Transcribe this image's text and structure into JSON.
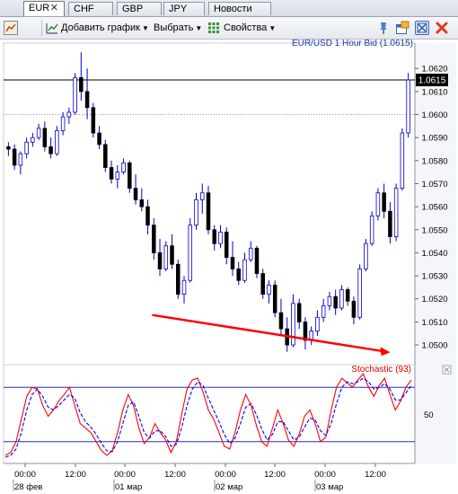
{
  "tabs": [
    {
      "label": "EUR",
      "close": "✕",
      "active": true
    },
    {
      "label": "CHF"
    },
    {
      "label": "GBP"
    },
    {
      "label": "JPY"
    },
    {
      "label": "Новости"
    }
  ],
  "toolbar": {
    "add_chart_label": "Добавить график",
    "select_label": "Выбрать",
    "properties_label": "Свойства"
  },
  "icons": [
    "chart-panel-icon",
    "layout-icon",
    "add-chart-icon",
    "properties-icon",
    "pin-icon",
    "new-window-icon",
    "zoom-icon",
    "close-icon"
  ],
  "colors": {
    "candle": "#0000cc",
    "stoch_main": "#ff0000",
    "stoch_signal": "#0000ff",
    "arrow": "#ff0000",
    "last_price_line": "#000000"
  },
  "chart_data": [
    {
      "type": "candlestick",
      "title": "EUR/USD 1 Hour Bid (1.0615)",
      "last_price": "1.0615",
      "y_tick_labels": [
        "1.0620",
        "1.0610",
        "1.0600",
        "1.0590",
        "1.0580",
        "1.0570",
        "1.0560",
        "1.0550",
        "1.0540",
        "1.0530",
        "1.0520",
        "1.0510",
        "1.0500"
      ],
      "ylim": [
        1.0493,
        1.0631
      ],
      "x_tick_labels": [
        "00:00",
        "12:00",
        "00:00",
        "12:00",
        "00:00",
        "12:00",
        "00:00",
        "12:00"
      ],
      "date_labels": [
        "28 фев",
        "01 мар",
        "02 мар",
        "03 мар"
      ],
      "grid": false,
      "dotted_reference_level": 1.06,
      "candles": [
        [
          1.0586,
          1.0588,
          1.0582,
          1.0585
        ],
        [
          1.0585,
          1.0587,
          1.0576,
          1.0578
        ],
        [
          1.0578,
          1.0584,
          1.0574,
          1.0583
        ],
        [
          1.0583,
          1.059,
          1.0581,
          1.0588
        ],
        [
          1.0588,
          1.0592,
          1.0586,
          1.059
        ],
        [
          1.059,
          1.0596,
          1.0589,
          1.0594
        ],
        [
          1.0594,
          1.0597,
          1.0584,
          1.0586
        ],
        [
          1.0586,
          1.059,
          1.0581,
          1.0583
        ],
        [
          1.0583,
          1.0595,
          1.0582,
          1.0593
        ],
        [
          1.0593,
          1.0601,
          1.0591,
          1.0599
        ],
        [
          1.0599,
          1.0603,
          1.0596,
          1.0601
        ],
        [
          1.0601,
          1.0618,
          1.06,
          1.0616
        ],
        [
          1.0616,
          1.0627,
          1.0606,
          1.061
        ],
        [
          1.061,
          1.062,
          1.0598,
          1.0603
        ],
        [
          1.0603,
          1.0605,
          1.059,
          1.0592
        ],
        [
          1.0592,
          1.0595,
          1.0585,
          1.0587
        ],
        [
          1.0587,
          1.0589,
          1.0575,
          1.0577
        ],
        [
          1.0577,
          1.058,
          1.057,
          1.0572
        ],
        [
          1.0572,
          1.0578,
          1.0568,
          1.0575
        ],
        [
          1.0575,
          1.0581,
          1.0574,
          1.0579
        ],
        [
          1.0579,
          1.058,
          1.0566,
          1.0568
        ],
        [
          1.0568,
          1.0574,
          1.0561,
          1.0563
        ],
        [
          1.0563,
          1.0568,
          1.0558,
          1.056
        ],
        [
          1.056,
          1.0563,
          1.0548,
          1.0552
        ],
        [
          1.0552,
          1.0555,
          1.0537,
          1.054
        ],
        [
          1.054,
          1.0546,
          1.053,
          1.0533
        ],
        [
          1.0533,
          1.0545,
          1.0532,
          1.0543
        ],
        [
          1.0543,
          1.0548,
          1.0533,
          1.0535
        ],
        [
          1.0535,
          1.0537,
          1.052,
          1.0522
        ],
        [
          1.0522,
          1.053,
          1.0518,
          1.0528
        ],
        [
          1.0528,
          1.0555,
          1.0527,
          1.0552
        ],
        [
          1.0552,
          1.0566,
          1.055,
          1.0563
        ],
        [
          1.0563,
          1.057,
          1.0557,
          1.0566
        ],
        [
          1.0566,
          1.0569,
          1.0548,
          1.055
        ],
        [
          1.055,
          1.0552,
          1.0541,
          1.0544
        ],
        [
          1.0544,
          1.0552,
          1.0542,
          1.0549
        ],
        [
          1.0549,
          1.0551,
          1.0535,
          1.0538
        ],
        [
          1.0538,
          1.0545,
          1.053,
          1.0533
        ],
        [
          1.0533,
          1.0536,
          1.0526,
          1.0528
        ],
        [
          1.0528,
          1.054,
          1.0527,
          1.0537
        ],
        [
          1.0537,
          1.0545,
          1.0536,
          1.0542
        ],
        [
          1.0542,
          1.0543,
          1.0529,
          1.0531
        ],
        [
          1.0531,
          1.0533,
          1.052,
          1.0522
        ],
        [
          1.0522,
          1.0528,
          1.0518,
          1.0526
        ],
        [
          1.0526,
          1.0528,
          1.0512,
          1.0514
        ],
        [
          1.0514,
          1.052,
          1.0504,
          1.0507
        ],
        [
          1.0507,
          1.0512,
          1.0497,
          1.05
        ],
        [
          1.05,
          1.0522,
          1.0499,
          1.0518
        ],
        [
          1.0518,
          1.052,
          1.0507,
          1.051
        ],
        [
          1.051,
          1.0512,
          1.0498,
          1.0502
        ],
        [
          1.0502,
          1.0508,
          1.05,
          1.0506
        ],
        [
          1.0506,
          1.0515,
          1.0504,
          1.0512
        ],
        [
          1.0512,
          1.052,
          1.051,
          1.0517
        ],
        [
          1.0517,
          1.0523,
          1.0515,
          1.0521
        ],
        [
          1.0521,
          1.0524,
          1.0513,
          1.0516
        ],
        [
          1.0516,
          1.0526,
          1.0515,
          1.0524
        ],
        [
          1.0524,
          1.0525,
          1.0517,
          1.0519
        ],
        [
          1.0519,
          1.0521,
          1.0509,
          1.0512
        ],
        [
          1.0512,
          1.0535,
          1.0511,
          1.0533
        ],
        [
          1.0533,
          1.0546,
          1.0532,
          1.0544
        ],
        [
          1.0544,
          1.0558,
          1.0543,
          1.0556
        ],
        [
          1.0556,
          1.0568,
          1.0554,
          1.0566
        ],
        [
          1.0566,
          1.057,
          1.0555,
          1.0558
        ],
        [
          1.0558,
          1.0562,
          1.0544,
          1.0547
        ],
        [
          1.0547,
          1.057,
          1.0545,
          1.0568
        ],
        [
          1.0568,
          1.0594,
          1.0567,
          1.0592
        ],
        [
          1.0592,
          1.0618,
          1.059,
          1.0615
        ]
      ]
    },
    {
      "type": "line",
      "title": "Stochastic (93)",
      "y_tick_labels": [
        "50"
      ],
      "ylim": [
        0,
        100
      ],
      "levels": [
        80,
        20
      ],
      "series": [
        {
          "values": [
            5,
            8,
            20,
            45,
            70,
            80,
            78,
            60,
            48,
            55,
            65,
            72,
            80,
            60,
            40,
            35,
            30,
            20,
            10,
            5,
            10,
            30,
            55,
            72,
            60,
            35,
            18,
            25,
            40,
            30,
            22,
            8,
            20,
            50,
            78,
            88,
            90,
            75,
            55,
            45,
            30,
            15,
            12,
            30,
            55,
            72,
            60,
            38,
            20,
            15,
            35,
            55,
            40,
            22,
            15,
            28,
            48,
            55,
            40,
            20,
            25,
            55,
            80,
            90,
            85,
            80,
            88,
            95,
            80,
            70,
            82,
            90,
            72,
            55,
            65,
            80,
            88
          ]
        },
        {
          "values": [
            3,
            5,
            12,
            30,
            55,
            72,
            78,
            70,
            58,
            55,
            60,
            66,
            72,
            68,
            52,
            42,
            36,
            28,
            18,
            10,
            9,
            20,
            40,
            60,
            64,
            48,
            30,
            24,
            32,
            32,
            26,
            15,
            17,
            35,
            60,
            78,
            86,
            82,
            68,
            55,
            42,
            28,
            18,
            24,
            40,
            58,
            62,
            50,
            34,
            22,
            28,
            42,
            42,
            32,
            22,
            25,
            36,
            46,
            44,
            32,
            27,
            40,
            62,
            80,
            86,
            84,
            86,
            90,
            86,
            78,
            80,
            84,
            78,
            66,
            66,
            74,
            82
          ]
        }
      ]
    }
  ]
}
